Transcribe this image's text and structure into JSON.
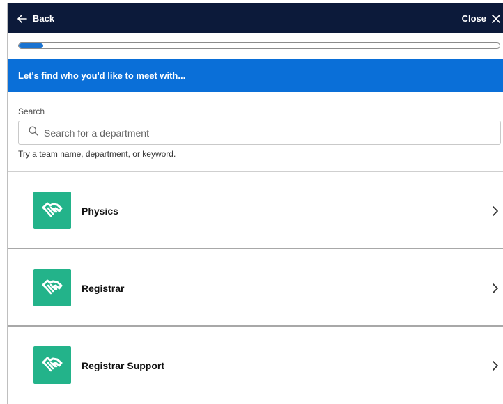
{
  "header": {
    "back_label": "Back",
    "close_label": "Close",
    "background": "#0c1a3a"
  },
  "progress": {
    "fraction": 0.05,
    "color": "#1a73d1"
  },
  "banner": {
    "text": "Let's find who you'd like to meet with...",
    "background": "#0a6fd8"
  },
  "search": {
    "label": "Search",
    "placeholder": "Search for a department",
    "value": "",
    "hint": "Try a team name, department, or keyword."
  },
  "departments": [
    {
      "name": "Physics",
      "icon": "handshake-icon"
    },
    {
      "name": "Registrar",
      "icon": "handshake-icon"
    },
    {
      "name": "Registrar Support",
      "icon": "handshake-icon"
    }
  ],
  "colors": {
    "icon_tile": "#23b38a"
  }
}
